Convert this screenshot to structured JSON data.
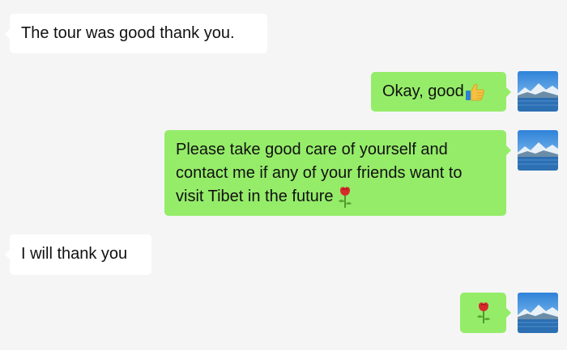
{
  "messages": [
    {
      "direction": "incoming",
      "text": "The tour was good thank you."
    },
    {
      "direction": "outgoing",
      "text": "Okay, good",
      "emoji": "thumbs-up-icon"
    },
    {
      "direction": "outgoing",
      "lines": [
        "Please take good care of yourself and",
        "contact me if any of your friends want to",
        "visit Tibet in the future"
      ],
      "emoji": "rose-icon"
    },
    {
      "direction": "incoming",
      "text": "I will thank you"
    },
    {
      "direction": "outgoing",
      "emoji": "rose-icon"
    }
  ],
  "colors": {
    "background": "#f5f5f5",
    "incoming_bubble": "#ffffff",
    "outgoing_bubble": "#95ec69",
    "text": "#111111"
  },
  "avatar": {
    "icon": "mountain-lake-avatar-icon"
  }
}
